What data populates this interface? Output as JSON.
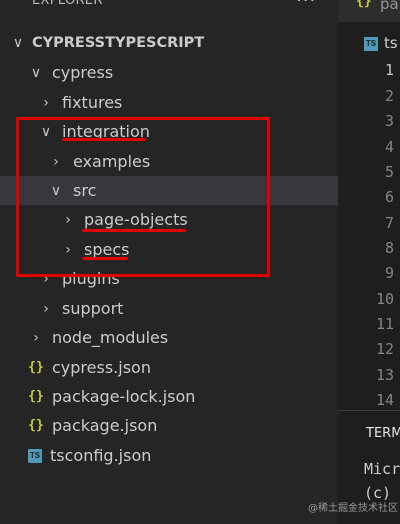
{
  "explorer": {
    "title": "EXPLORER",
    "more_actions": "···",
    "items": [
      {
        "label": "CYPRESSTYPESCRIPT",
        "chevron": "∨"
      },
      {
        "label": "cypress",
        "chevron": "∨"
      },
      {
        "label": "fixtures",
        "chevron": "›"
      },
      {
        "label": "integration",
        "chevron": "∨"
      },
      {
        "label": "examples",
        "chevron": "›"
      },
      {
        "label": "src",
        "chevron": "∨"
      },
      {
        "label": "page-objects",
        "chevron": "›"
      },
      {
        "label": "specs",
        "chevron": "›"
      },
      {
        "label": "plugins",
        "chevron": "›"
      },
      {
        "label": "support",
        "chevron": "›"
      },
      {
        "label": "node_modules",
        "chevron": "›"
      },
      {
        "label": "cypress.json",
        "icon": "{}"
      },
      {
        "label": "package-lock.json",
        "icon": "{}"
      },
      {
        "label": "package.json",
        "icon": "{}"
      },
      {
        "label": "tsconfig.json",
        "icon": "TS"
      }
    ]
  },
  "editor": {
    "tab_icon": "{}",
    "tab_label": "pa",
    "breadcrumb_icon": "TS",
    "breadcrumb_label": "ts",
    "line_numbers": [
      "1",
      "2",
      "3",
      "4",
      "5",
      "6",
      "7",
      "8",
      "9",
      "10",
      "11",
      "12",
      "13",
      "14"
    ]
  },
  "terminal": {
    "tab_label": "TERM",
    "line1": "Micr",
    "line2": "(c)"
  },
  "watermark": "@稀土掘金技术社区",
  "colors": {
    "sidebar_bg": "#252526",
    "editor_bg": "#1e1e1e",
    "selection_bg": "#37373d",
    "annotation_red": "#e00000",
    "json_icon": "#cbcb41",
    "ts_icon": "#519aba"
  }
}
